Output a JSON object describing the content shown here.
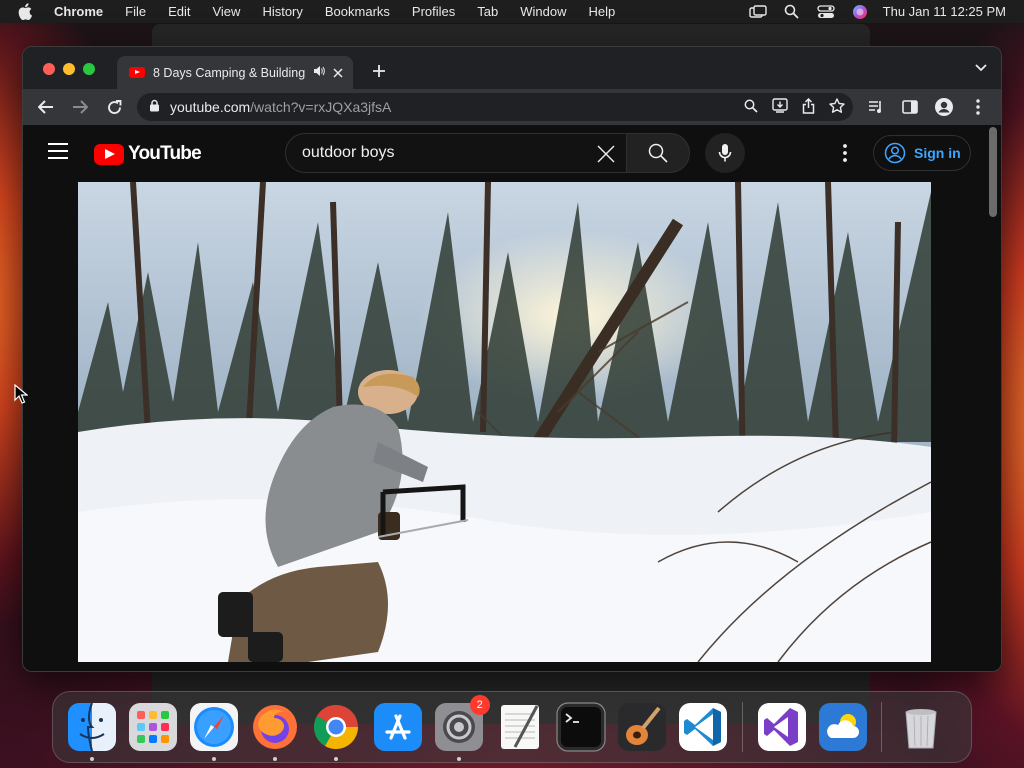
{
  "menubar": {
    "app_name": "Chrome",
    "items": [
      "File",
      "Edit",
      "View",
      "History",
      "Bookmarks",
      "Profiles",
      "Tab",
      "Window",
      "Help"
    ],
    "clock": "Thu Jan 11  12:25 PM"
  },
  "browser": {
    "tab": {
      "title": "8 Days Camping & Building",
      "favicon": "youtube-icon"
    },
    "address": {
      "host": "youtube.com",
      "path": "/watch?v=rxJQXa3jfsA"
    }
  },
  "youtube": {
    "logo_text": "YouTube",
    "search": {
      "value": "outdoor boys"
    },
    "signin_label": "Sign in"
  },
  "dock": {
    "apps": [
      {
        "name": "finder-icon",
        "running": true
      },
      {
        "name": "launchpad-icon",
        "running": false
      },
      {
        "name": "safari-icon",
        "running": true
      },
      {
        "name": "firefox-icon",
        "running": true
      },
      {
        "name": "chrome-icon",
        "running": true
      },
      {
        "name": "app-store-icon",
        "running": false
      },
      {
        "name": "system-settings-icon",
        "running": true,
        "badge": "2"
      },
      {
        "name": "textedit-icon",
        "running": false
      },
      {
        "name": "terminal-icon",
        "running": false
      },
      {
        "name": "garageband-icon",
        "running": false
      },
      {
        "name": "vscode-icon",
        "running": false
      },
      {
        "name": "visual-studio-icon",
        "running": false
      },
      {
        "name": "weather-icon",
        "running": false
      },
      {
        "name": "trash-icon",
        "running": false
      }
    ]
  }
}
